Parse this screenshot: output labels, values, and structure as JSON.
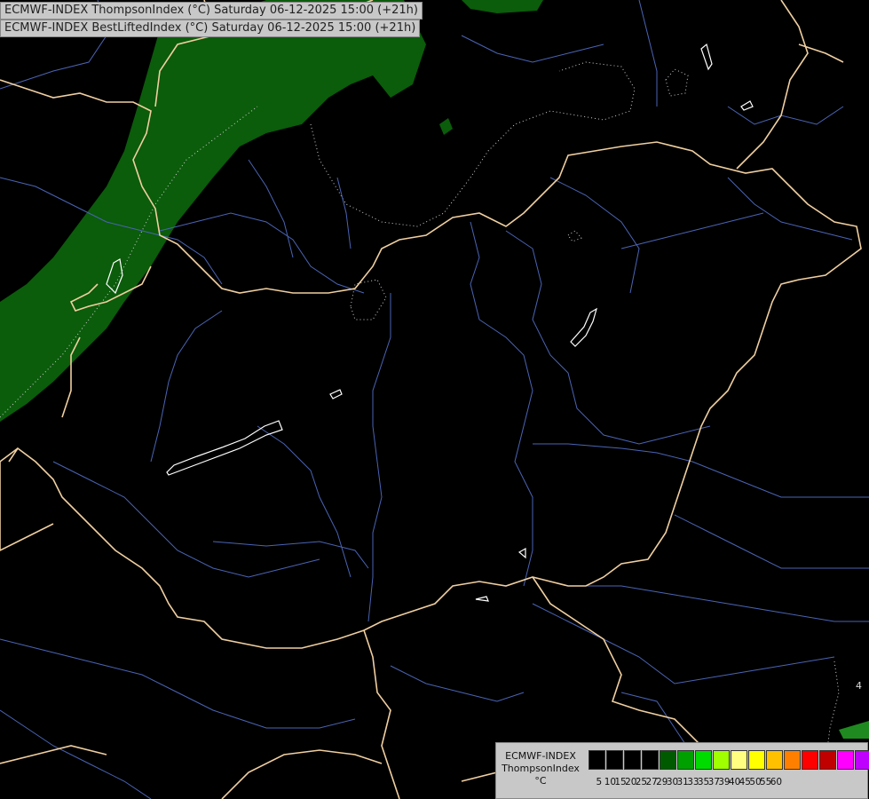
{
  "titles": {
    "line1": "ECMWF-INDEX ThompsonIndex (°C) Saturday 06-12-2025 15:00 (+21h)",
    "line2": "ECMWF-INDEX BestLiftedIndex (°C) Saturday 06-12-2025 15:00 (+21h)"
  },
  "legend": {
    "name_line1": "ECMWF-INDEX",
    "name_line2": "ThompsonIndex",
    "unit": "°C",
    "colors": [
      "#000000",
      "#000000",
      "#000000",
      "#000000",
      "#005a00",
      "#00a000",
      "#00dc00",
      "#a0ff00",
      "#ffff80",
      "#ffff00",
      "#ffc000",
      "#ff8000",
      "#ff0000",
      "#c00000",
      "#ff00ff",
      "#c000ff",
      "#8000ff",
      "#0000ff"
    ],
    "ticks": [
      "5",
      "10",
      "15",
      "20",
      "25",
      "27",
      "29",
      "30",
      "31",
      "33",
      "35",
      "37",
      "39",
      "40",
      "45",
      "50",
      "55",
      "60"
    ]
  },
  "map_labels": {
    "contour_value": "4"
  },
  "colors": {
    "background": "#000000",
    "border": "#f5d5a8",
    "river": "#5a78c8",
    "green_band": "#0b5c0b",
    "green_bright": "#1f8a1f",
    "lake_outline": "#ffffff"
  }
}
